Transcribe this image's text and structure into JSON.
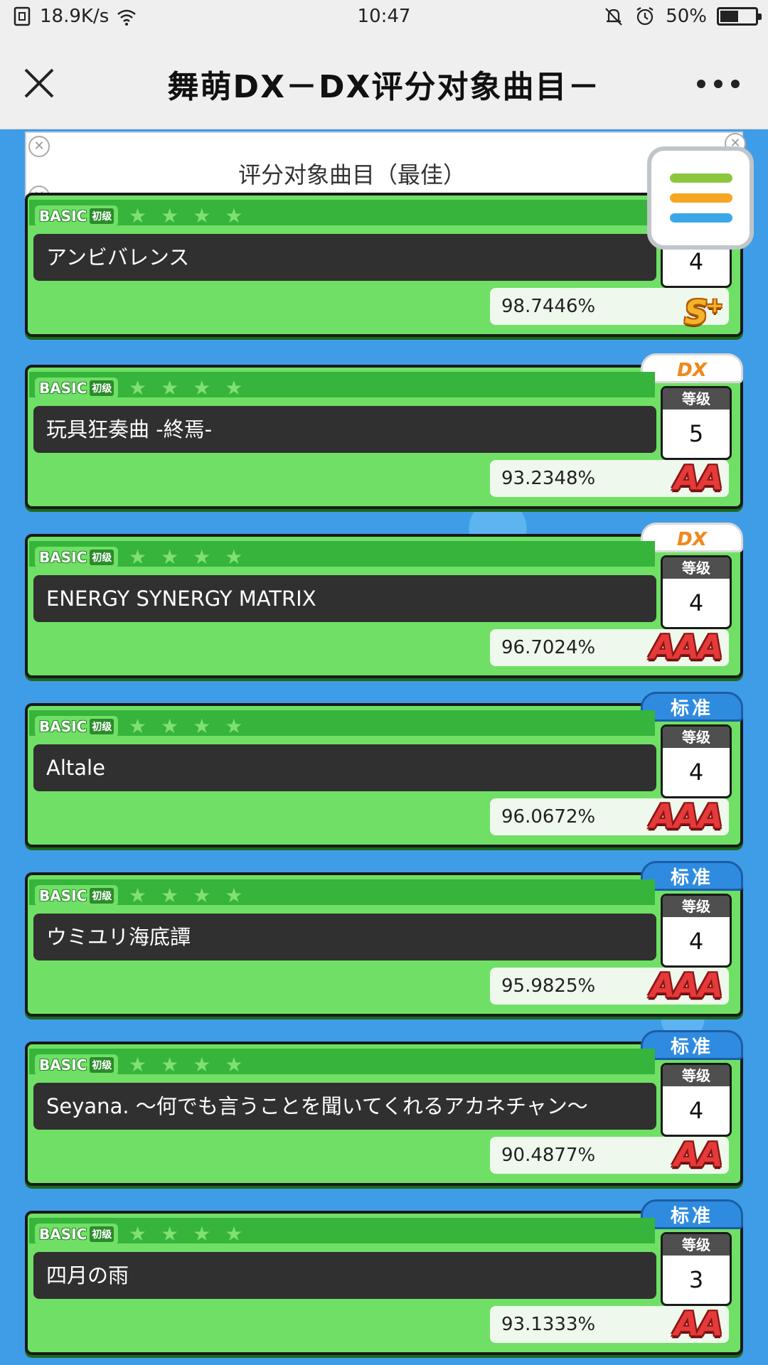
{
  "status_bar": {
    "speed": "18.9K/s",
    "time": "10:47",
    "battery": "50%",
    "battery_level": 0.5
  },
  "header": {
    "title": "舞萌DX－DX评分对象曲目－"
  },
  "section": {
    "label": "评分对象曲目（最佳）"
  },
  "labels": {
    "basic": "BASIC",
    "basic_cn": "初级",
    "level_head": "等级",
    "dx": "DX",
    "std": "标准"
  },
  "menu_colors": [
    "#8cc63f",
    "#f5a623",
    "#3aa8e8"
  ],
  "songs": [
    {
      "title": "アンビバレンス",
      "score": "98.7446%",
      "rank": "S+",
      "level": "4",
      "type": ""
    },
    {
      "title": "玩具狂奏曲 -終焉-",
      "score": "93.2348%",
      "rank": "AA",
      "level": "5",
      "type": "DX"
    },
    {
      "title": "ENERGY SYNERGY MATRIX",
      "score": "96.7024%",
      "rank": "AAA",
      "level": "4",
      "type": "DX"
    },
    {
      "title": "Altale",
      "score": "96.0672%",
      "rank": "AAA",
      "level": "4",
      "type": "标准"
    },
    {
      "title": "ウミユリ海底譚",
      "score": "95.9825%",
      "rank": "AAA",
      "level": "4",
      "type": "标准"
    },
    {
      "title": "Seyana. ～何でも言うことを聞いてくれるアカネチャン～",
      "score": "90.4877%",
      "rank": "AA",
      "level": "4",
      "type": "标准"
    },
    {
      "title": "四月の雨",
      "score": "93.1333%",
      "rank": "AA",
      "level": "3",
      "type": "标准"
    }
  ]
}
